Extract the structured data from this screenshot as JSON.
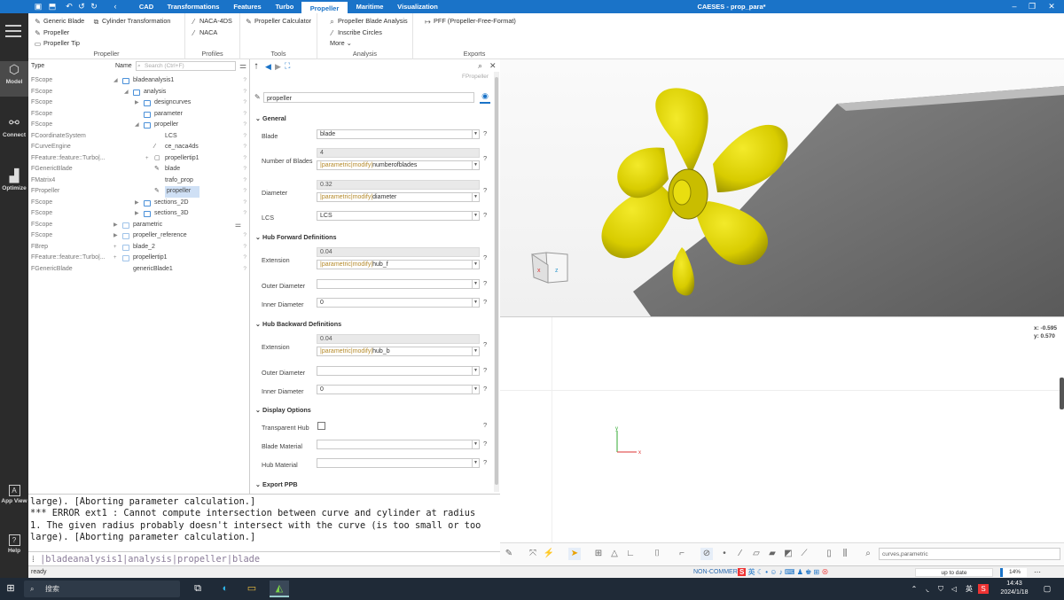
{
  "window": {
    "title": "CAESES - prop_para*"
  },
  "tabs": [
    {
      "label": "CAD"
    },
    {
      "label": "Transformations"
    },
    {
      "label": "Features"
    },
    {
      "label": "Turbo"
    },
    {
      "label": "Propeller"
    },
    {
      "label": "Maritime"
    },
    {
      "label": "Visualization"
    }
  ],
  "ribbon": {
    "propeller": {
      "items": [
        "Generic Blade",
        "Propeller",
        "Propeller Tip",
        "Cylinder Transformation"
      ],
      "label": "Propeller"
    },
    "profiles": {
      "items": [
        "NACA-4DS",
        "NACA"
      ],
      "label": "Profiles"
    },
    "tools": {
      "items": [
        "Propeller Calculator"
      ],
      "label": "Tools"
    },
    "analysis": {
      "items": [
        "Propeller Blade Analysis",
        "Inscribe Circles",
        "More"
      ],
      "label": "Analysis"
    },
    "exports": {
      "items": [
        "PFF (Propeller-Free-Format)"
      ],
      "label": "Exports"
    }
  },
  "sidebar": [
    {
      "label": "Model",
      "icon": "cube-icon"
    },
    {
      "label": "Connect",
      "icon": "connect-icon"
    },
    {
      "label": "Optimize",
      "icon": "chart-icon"
    },
    {
      "label": "App View",
      "icon": "app-view-icon"
    },
    {
      "label": "Help",
      "icon": "help-icon"
    }
  ],
  "tree": {
    "header": {
      "type": "Type",
      "name": "Name",
      "search_placeholder": "Search (Ctrl+F)"
    },
    "rows": [
      {
        "type": "FScope",
        "name": "bladeanalysis1",
        "q": "?"
      },
      {
        "type": "FScope",
        "name": "analysis",
        "q": "?"
      },
      {
        "type": "FScope",
        "name": "designcurves",
        "q": "?"
      },
      {
        "type": "FScope",
        "name": "parameter",
        "q": "?"
      },
      {
        "type": "FScope",
        "name": "propeller",
        "q": "?"
      },
      {
        "type": "FCoordinateSystem",
        "name": "LCS",
        "q": "?"
      },
      {
        "type": "FCurveEngine",
        "name": "ce_naca4ds",
        "q": "?"
      },
      {
        "type": "FFeature::feature::Turbo|...",
        "name": "propellertip1",
        "q": "?"
      },
      {
        "type": "FGenericBlade",
        "name": "blade",
        "q": "?"
      },
      {
        "type": "FMatrix4",
        "name": "trafo_prop",
        "q": "?"
      },
      {
        "type": "FPropeller",
        "name": "propeller",
        "q": "?"
      },
      {
        "type": "FScope",
        "name": "sections_2D",
        "q": "?"
      },
      {
        "type": "FScope",
        "name": "sections_3D",
        "q": "?"
      },
      {
        "type": "FScope",
        "name": "parametric",
        "q": ""
      },
      {
        "type": "FScope",
        "name": "propeller_reference",
        "q": "?"
      },
      {
        "type": "FBrep",
        "name": "blade_2",
        "q": "?"
      },
      {
        "type": "FFeature::feature::Turbo|...",
        "name": "propellertip1",
        "q": "?"
      },
      {
        "type": "FGenericBlade",
        "name": "genericBlade1",
        "q": "?"
      }
    ]
  },
  "props": {
    "object_type": "FPropeller",
    "name_value": "propeller",
    "general": "General",
    "blade_label": "Blade",
    "blade_value": "blade",
    "nblades_label": "Number of Blades",
    "nblades_value": "4",
    "nblades_expr_prefix": "|parametric|modify|",
    "nblades_expr": "numberofblades",
    "diameter_label": "Diameter",
    "diameter_value": "0.32",
    "diameter_expr_prefix": "|parametric|modify|",
    "diameter_expr": "diameter",
    "lcs_label": "LCS",
    "lcs_value": "LCS",
    "hubfwd": "Hub Forward Definitions",
    "ext_label": "Extension",
    "hubf_value": "0.04",
    "hubf_expr_prefix": "|parametric|modify|",
    "hubf_expr": "hub_f",
    "outer_label": "Outer Diameter",
    "outer_value": "",
    "inner_label": "Inner Diameter",
    "inner_value": "0",
    "hubback": "Hub Backward Definitions",
    "hubb_value": "0.04",
    "hubb_expr_prefix": "|parametric|modify|",
    "hubb_expr": "hub_b",
    "display": "Display Options",
    "transp_label": "Transparent Hub",
    "bmat_label": "Blade Material",
    "hmat_label": "Hub Material",
    "export": "Export PPB",
    "q": "?"
  },
  "console": {
    "lines": [
      "large). [Aborting parameter calculation.]",
      "*** ERROR ext1 : Cannot compute intersection between curve and cylinder at radius",
      "1. The given radius probably doesn't intersect with the curve (is too small or too",
      "large). [Aborting parameter calculation.]"
    ],
    "prompt": "|bladeanalysis1|analysis|propeller|blade"
  },
  "status": {
    "left": "ready",
    "mode": "NON-COMMER",
    "update": "up to date",
    "zoom": "14%"
  },
  "viewport": {
    "coord_x": "x: -0.595",
    "coord_y": "y:  0.570",
    "search_value": "curves,parametric"
  },
  "taskbar": {
    "search": "搜索",
    "time": "14:43",
    "date": "2024/1/18",
    "ime": "英"
  },
  "colors": {
    "accent": "#1a73c8",
    "propeller": "#d8cc00"
  }
}
